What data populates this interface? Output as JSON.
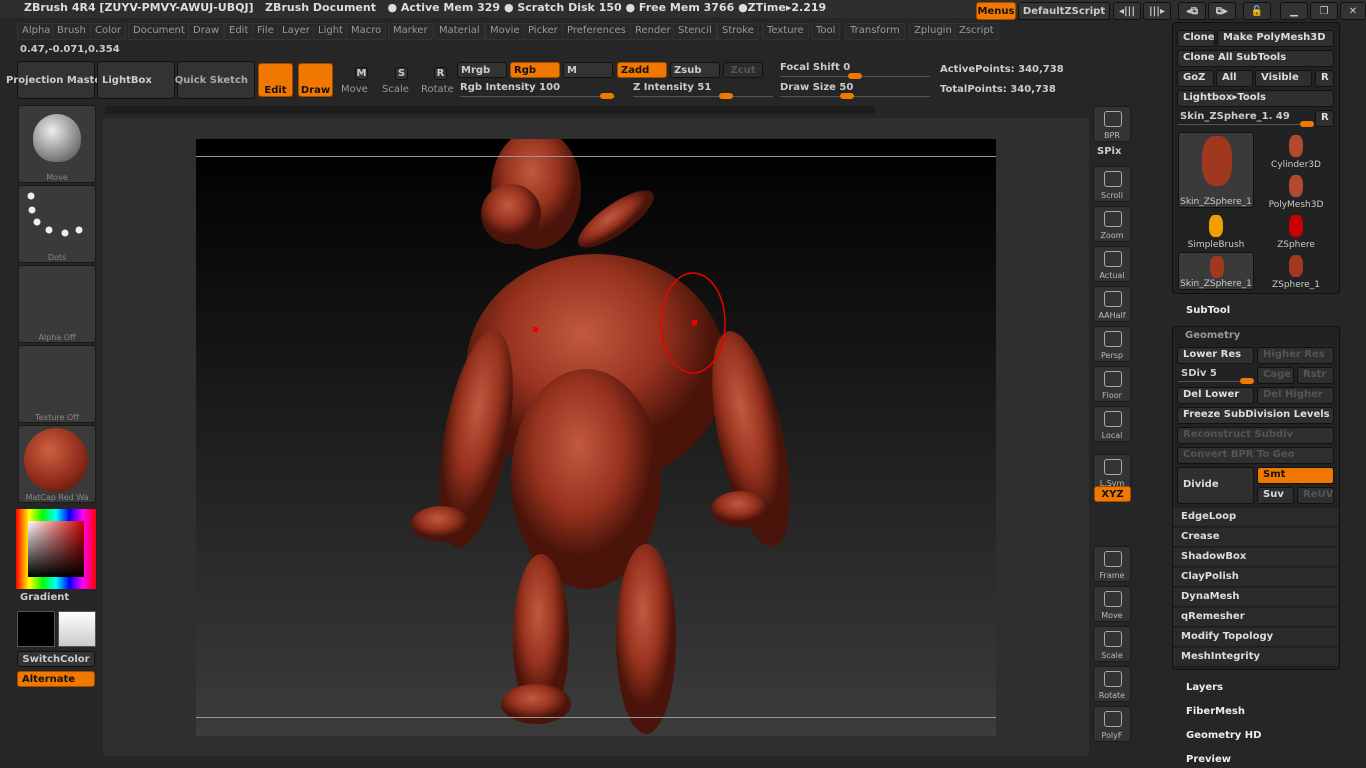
{
  "title": {
    "app": "ZBrush 4R4 [ZUYV-PMVY-AWUJ-UBQJ]",
    "document": "ZBrush Document",
    "active_mem": "● Active Mem 329",
    "scratch": "● Scratch Disk 150",
    "free_mem": "● Free Mem 3766",
    "ztime": "●ZTime▸2.219"
  },
  "topright": {
    "menus": "Menus",
    "script": "DefaultZScript"
  },
  "menu": [
    "Alpha",
    "Brush",
    "Color",
    "Document",
    "Draw",
    "Edit",
    "File",
    "Layer",
    "Light",
    "Macro",
    "Marker",
    "Material",
    "Movie",
    "Picker",
    "Preferences",
    "Render",
    "Stencil",
    "Stroke",
    "Texture",
    "Tool",
    "Transform",
    "Zplugin",
    "Zscript"
  ],
  "coords": "0.47,-0.071,0.354",
  "toolbar": {
    "projection": "Projection Master",
    "lightbox": "LightBox",
    "quick_sketch": "Quick Sketch",
    "edit": "Edit",
    "draw": "Draw",
    "move": "Move",
    "scale": "Scale",
    "rotate": "Rotate",
    "mrgb": "Mrgb",
    "rgb": "Rgb",
    "m": "M",
    "zadd": "Zadd",
    "zsub": "Zsub",
    "zcut": "Zcut",
    "rgb_intensity": "Rgb Intensity 100",
    "z_intensity": "Z Intensity 51",
    "focal_shift": "Focal Shift 0",
    "draw_size": "Draw Size 50",
    "active_points": "ActivePoints: 340,738",
    "total_points": "TotalPoints: 340,738"
  },
  "sliders": {
    "rgb_intensity": 100,
    "z_intensity": 51,
    "focal_shift": 0,
    "draw_size": 50
  },
  "left_shelf": {
    "brush": "Move",
    "stroke": "Dots",
    "alpha": "Alpha Off",
    "texture": "Texture Off",
    "material": "MatCap Red Wa",
    "gradient": "Gradient",
    "switchcolor": "SwitchColor",
    "alternate": "Alternate"
  },
  "right_shelf": [
    "BPR",
    "SPix",
    "Scroll",
    "Zoom",
    "Actual",
    "AAHalf",
    "Persp",
    "Floor",
    "Local",
    "L.Sym",
    "XYZ",
    "Frame",
    "Move",
    "Scale",
    "Rotate",
    "PolyF"
  ],
  "tool_panel": {
    "clone": "Clone",
    "make_polymesh": "Make PolyMesh3D",
    "clone_all": "Clone All SubTools",
    "goz": "GoZ",
    "all": "All",
    "visible": "Visible",
    "r": "R",
    "lightbox_tools": "Lightbox▸Tools",
    "current_tool": "Skin_ZSphere_1. 49",
    "tools": [
      "Skin_ZSphere_1",
      "Cylinder3D",
      "PolyMesh3D",
      "SimpleBrush",
      "ZSphere",
      "Skin_ZSphere_1",
      "ZSphere_1"
    ]
  },
  "subtool": "SubTool",
  "geometry": {
    "header": "Geometry",
    "lower_res": "Lower Res",
    "higher_res": "Higher Res",
    "sdiv": "SDiv 5",
    "cage": "Cage",
    "rstr": "Rstr",
    "del_lower": "Del Lower",
    "del_higher": "Del Higher",
    "freeze": "Freeze SubDivision Levels",
    "reconstruct": "Reconstruct Subdiv",
    "convert_bpr": "Convert BPR To Geo",
    "divide": "Divide",
    "smt": "Smt",
    "suv": "Suv",
    "reuv": "ReUV",
    "items": [
      "EdgeLoop",
      "Crease",
      "ShadowBox",
      "ClayPolish",
      "DynaMesh",
      "qRemesher",
      "Modify Topology",
      "MeshIntegrity"
    ]
  },
  "sections": [
    "Layers",
    "FiberMesh",
    "Geometry HD",
    "Preview"
  ],
  "colors": {
    "accent": "#f07800",
    "model": "#9a3420",
    "bg": "#262626"
  }
}
